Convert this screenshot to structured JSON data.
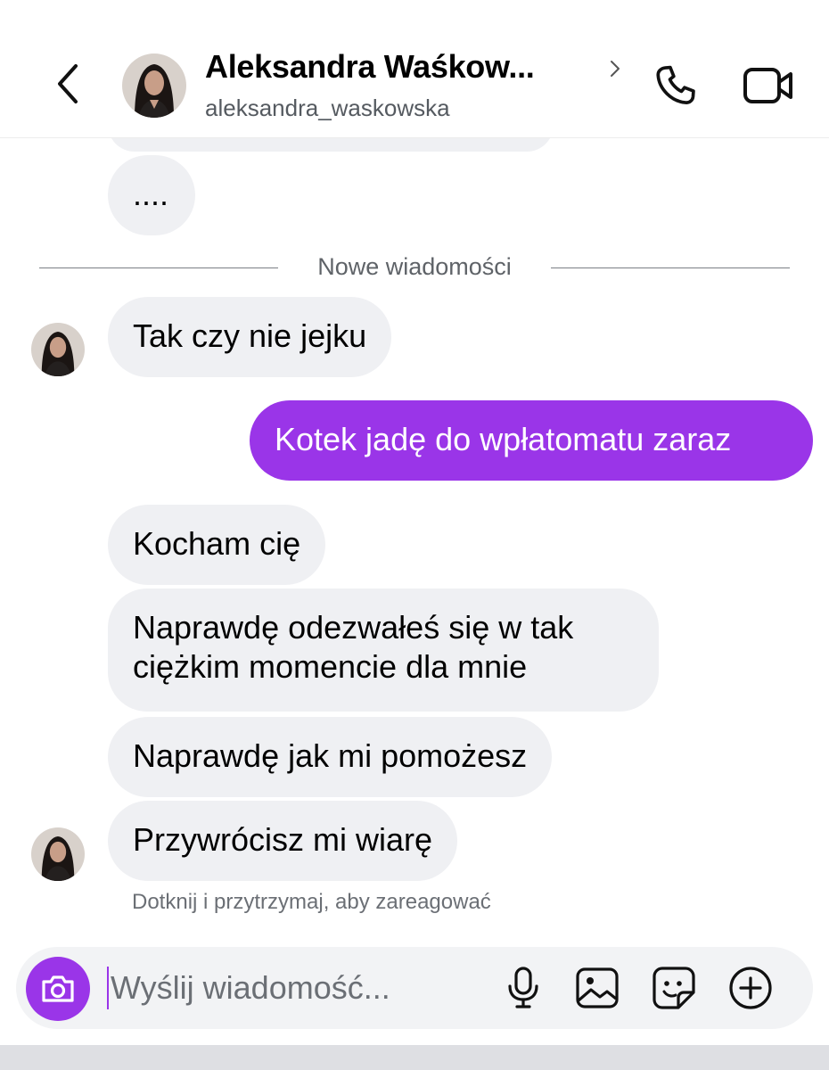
{
  "header": {
    "contact_name": "Aleksandra Waśkow...",
    "username": "aleksandra_waskowska",
    "icons": {
      "back": "chevron-left-icon",
      "more": "chevron-right-icon",
      "call": "phone-icon",
      "video": "video-camera-icon"
    }
  },
  "messages": {
    "m0": "....",
    "m1": "Tak czy nie jejku",
    "m2": "Kotek jadę do wpłatomatu zaraz",
    "m3": "Kocham cię",
    "m4": "Naprawdę odezwałeś się w tak ciężkim momencie dla mnie",
    "m5": "Naprawdę jak mi pomożesz",
    "m6": "Przywrócisz mi wiarę"
  },
  "divider_label": "Nowe wiadomości",
  "reaction_hint": "Dotknij i przytrzymaj, aby zareagować",
  "composer": {
    "placeholder": "Wyślij wiadomość...",
    "value": "",
    "icons": [
      "camera-icon",
      "microphone-icon",
      "image-icon",
      "sticker-icon",
      "add-circle-icon"
    ]
  },
  "colors": {
    "accent": "#9a35e8",
    "incoming_bubble": "#eff0f3",
    "secondary_text": "#555a60"
  }
}
